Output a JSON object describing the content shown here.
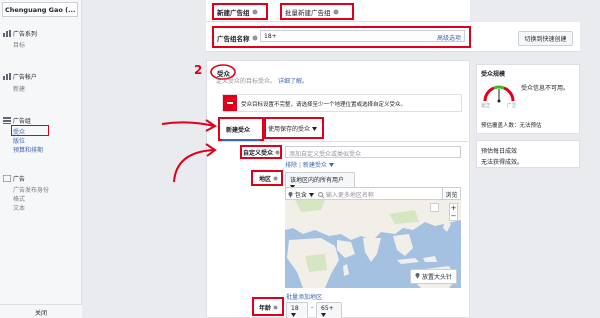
{
  "sidebar": {
    "account_name": "Chenguang Gao (...",
    "campaign": {
      "title": "广告系列",
      "sub": "目标"
    },
    "account": {
      "title": "广告帐户",
      "sub": "新建"
    },
    "adset": {
      "title": "广告组",
      "items": [
        "受众",
        "版位",
        "预算和排期"
      ]
    },
    "ad": {
      "title": "广告",
      "items": [
        "广告发布身份",
        "格式",
        "文本"
      ]
    },
    "close_label": "关闭"
  },
  "tabs": {
    "new_adset": "新建广告组",
    "batch_create": "批量新建广告组"
  },
  "adset_name": {
    "label": "广告组名称",
    "value": "18+",
    "advanced": "高级选项",
    "switch_button": "切换到快速创建"
  },
  "audience": {
    "number_marker": "2",
    "title": "受众",
    "intro": "定义受众的目标受众。",
    "learn_more": "详细了解。",
    "error_text": "受众目标设置不完整，请选择至少一个地理位置或选择自定义受众。",
    "tab_new": "新建受众",
    "tab_saved": "使用保存的受众",
    "custom_label": "自定义受众",
    "custom_placeholder": "添加自定义受众或类似受众",
    "exclude": "排除",
    "create_new": "新建受众",
    "location_label": "地区",
    "location_select": "该地区内的所有用户",
    "include": "包含",
    "location_placeholder": "输入更多地区名称",
    "browse": "浏览",
    "pin_label": "放置大头针",
    "batch_add": "批量添加地区",
    "age_label": "年龄",
    "age_min": "18",
    "age_max": "65+"
  },
  "audience_size": {
    "title": "受众规模",
    "desc": "受众信息不可用。",
    "gauge_left": "宽泛",
    "gauge_right": "广泛",
    "reach_label": "预估覆盖人数：",
    "reach_value": "无法预估"
  },
  "daily_results": {
    "title": "预估每日成效",
    "value": "无法获得成效。"
  },
  "colors": {
    "annotation_red": "#e0001b",
    "link_blue": "#4267b2",
    "gauge_green": "#42b72a"
  }
}
